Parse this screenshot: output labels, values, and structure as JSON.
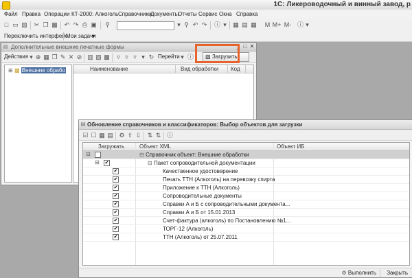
{
  "app": {
    "title": "1С: Ликероводочный и винный завод, р"
  },
  "menu": {
    "items": [
      "Файл",
      "Правка",
      "Операции",
      "КТ-2000: Алкоголь",
      "Справочники",
      "Документы",
      "Отчеты",
      "Сервис",
      "Окна",
      "Справка"
    ]
  },
  "toolbar": {
    "m": "M",
    "m_plus": "M+",
    "m_minus": "M-"
  },
  "toolbar2": {
    "switch_interface": "Переключить интерфейс",
    "my_tasks": "Мои задачи"
  },
  "window1": {
    "title": "Дополнительные внешние печатные формы",
    "actions": "Действия",
    "goto": "Перейти",
    "load": "Загрузить",
    "tree_node": "Внешние обрабо",
    "columns": [
      "Наименование",
      "Вид обработки",
      "Код"
    ]
  },
  "window2": {
    "title": "Обновление справочников и классификаторов: Выбор объектов для загрузки",
    "columns": [
      "Загружать",
      "Объект XML",
      "Объект ИБ"
    ],
    "rows": [
      {
        "label": "Справочник объект: Внешние обработки"
      },
      {
        "label": "Пакет сопроводительной документации"
      },
      {
        "label": "Качественное удостоверение"
      },
      {
        "label": "Печать ТТН (Алкоголь) на перевозку спирта"
      },
      {
        "label": "Приложение к ТТН  (Алкоголь)"
      },
      {
        "label": "Сопроводительные документы"
      },
      {
        "label": "Справки А и Б с сопроводительными документа..."
      },
      {
        "label": "Справки А и Б от 15.01.2013"
      },
      {
        "label": "Счет-фактура (алкоголь) по Постановлению №1..."
      },
      {
        "label": "ТОРГ-12 (Алкоголь)"
      },
      {
        "label": "ТТН (Алкоголь) от 25.07.2011"
      }
    ],
    "execute": "Выполнить",
    "close": "Закрыть"
  },
  "colors": {
    "highlight": "#e8622b",
    "selection": "#4a6fa0",
    "app_icon": "#f3c400"
  }
}
